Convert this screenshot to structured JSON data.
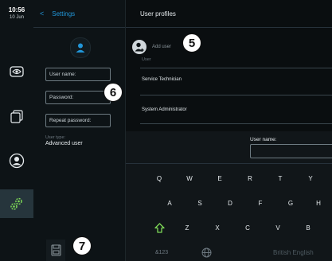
{
  "status": {
    "time": "10:56",
    "date": "10 Jun"
  },
  "left_panel": {
    "back_label": "<",
    "title": "Settings",
    "username_placeholder": "User name:",
    "password_placeholder": "Password:",
    "repeat_password_placeholder": "Repeat password:",
    "user_type_label": "User type:",
    "user_type_value": "Advanced user"
  },
  "main": {
    "title": "User profiles",
    "add_user_label": "Add user",
    "column_header": "User",
    "users": [
      "Service Technician",
      "System Administrator"
    ]
  },
  "keyboard": {
    "field_label": "User name:",
    "row1": [
      "Q",
      "W",
      "E",
      "R",
      "T",
      "Y"
    ],
    "row2": [
      "A",
      "S",
      "D",
      "F",
      "G",
      "H"
    ],
    "row3": [
      "Z",
      "X",
      "C",
      "V",
      "B"
    ],
    "numbers_key": "&123",
    "language_label": "British English"
  },
  "callouts": {
    "c5": "5",
    "c6": "6",
    "c7": "7"
  },
  "icons": [
    "eye-icon",
    "documents-icon",
    "user-icon",
    "gears-icon",
    "save-icon",
    "globe-icon",
    "shift-icon",
    "add-user-icon"
  ],
  "colors": {
    "accent": "#2196d9",
    "shift": "#7ed957",
    "background": "#0a0e10",
    "panel": "#0d1316"
  }
}
